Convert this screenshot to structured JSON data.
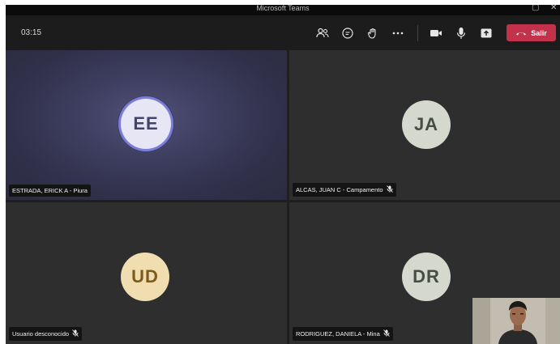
{
  "window": {
    "title": "Microsoft Teams"
  },
  "toolbar": {
    "timer": "03:15",
    "leave_label": "Salir",
    "icons": [
      "people-icon",
      "chat-icon",
      "raise-hand-icon",
      "more-icon",
      "camera-icon",
      "mic-icon",
      "share-icon",
      "phone-hangup-icon"
    ],
    "leave_color": "#c4314b"
  },
  "participants": [
    {
      "initials": "EE",
      "name": "ESTRADA, ERICK A - Piura",
      "muted": false,
      "speaking": true
    },
    {
      "initials": "JA",
      "name": "ALCAS, JUAN C - Campamento",
      "muted": true
    },
    {
      "initials": "UD",
      "name": "Usuario desconocido",
      "muted": true
    },
    {
      "initials": "DR",
      "name": "RODRIGUEZ, DANIELA - Mina",
      "muted": true
    }
  ],
  "self_view": {
    "type": "camera-preview"
  }
}
